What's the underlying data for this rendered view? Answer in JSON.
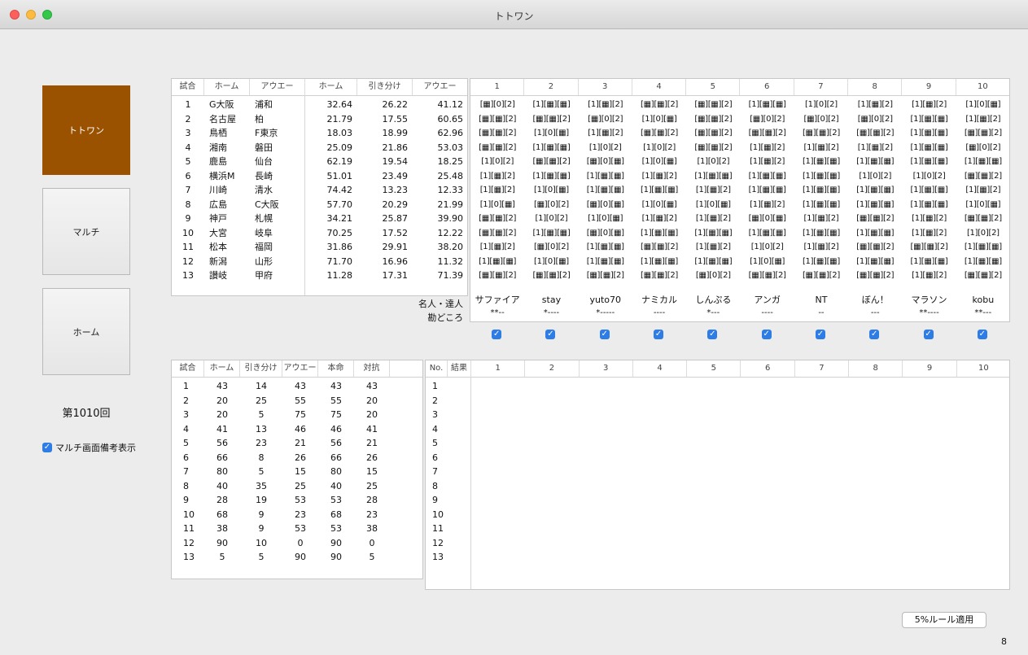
{
  "window": {
    "title": "トトワン"
  },
  "sidebar": {
    "totowan": "トトワン",
    "multi": "マルチ",
    "home": "ホーム",
    "round": "第1010回",
    "multi_note_label": "マルチ画面備考表示",
    "multi_note_checked": true
  },
  "odds_table": {
    "headers": [
      "試合",
      "ホーム",
      "アウエー",
      "ホーム",
      "引き分け",
      "アウエー"
    ],
    "rows": [
      [
        "1",
        "G大阪",
        "浦和",
        "32.64",
        "26.22",
        "41.12"
      ],
      [
        "2",
        "名古屋",
        "柏",
        "21.79",
        "17.55",
        "60.65"
      ],
      [
        "3",
        "鳥栖",
        "F東京",
        "18.03",
        "18.99",
        "62.96"
      ],
      [
        "4",
        "湘南",
        "磐田",
        "25.09",
        "21.86",
        "53.03"
      ],
      [
        "5",
        "鹿島",
        "仙台",
        "62.19",
        "19.54",
        "18.25"
      ],
      [
        "6",
        "横浜M",
        "長崎",
        "51.01",
        "23.49",
        "25.48"
      ],
      [
        "7",
        "川崎",
        "清水",
        "74.42",
        "13.23",
        "12.33"
      ],
      [
        "8",
        "広島",
        "C大阪",
        "57.70",
        "20.29",
        "21.99"
      ],
      [
        "9",
        "神戸",
        "札幌",
        "34.21",
        "25.87",
        "39.90"
      ],
      [
        "10",
        "大宮",
        "岐阜",
        "70.25",
        "17.52",
        "12.22"
      ],
      [
        "11",
        "松本",
        "福岡",
        "31.86",
        "29.91",
        "38.20"
      ],
      [
        "12",
        "新潟",
        "山形",
        "71.70",
        "16.96",
        "11.32"
      ],
      [
        "13",
        "讃岐",
        "甲府",
        "11.28",
        "17.31",
        "71.39"
      ]
    ]
  },
  "expert_table": {
    "headers": [
      "1",
      "2",
      "3",
      "4",
      "5",
      "6",
      "7",
      "8",
      "9",
      "10"
    ],
    "rows": [
      [
        "[▦][0][2]",
        "[1][▦][▦]",
        "[1][▦][2]",
        "[▦][▦][2]",
        "[▦][▦][2]",
        "[1][▦][▦]",
        "[1][0][2]",
        "[1][▦][2]",
        "[1][▦][2]",
        "[1][0][▦]"
      ],
      [
        "[▦][▦][2]",
        "[▦][▦][2]",
        "[▦][0][2]",
        "[1][0][▦]",
        "[▦][▦][2]",
        "[▦][0][2]",
        "[▦][0][2]",
        "[▦][0][2]",
        "[1][▦][▦]",
        "[1][▦][2]"
      ],
      [
        "[▦][▦][2]",
        "[1][0][▦]",
        "[1][▦][2]",
        "[▦][▦][2]",
        "[▦][▦][2]",
        "[▦][▦][2]",
        "[▦][▦][2]",
        "[▦][▦][2]",
        "[1][▦][▦]",
        "[▦][▦][2]"
      ],
      [
        "[▦][▦][2]",
        "[1][▦][▦]",
        "[1][0][2]",
        "[1][0][2]",
        "[▦][▦][2]",
        "[1][▦][2]",
        "[1][▦][2]",
        "[1][▦][2]",
        "[1][▦][▦]",
        "[▦][0][2]"
      ],
      [
        "[1][0][2]",
        "[▦][▦][2]",
        "[▦][0][▦]",
        "[1][0][▦]",
        "[1][0][2]",
        "[1][▦][2]",
        "[1][▦][▦]",
        "[1][▦][▦]",
        "[1][▦][▦]",
        "[1][▦][▦]"
      ],
      [
        "[1][▦][2]",
        "[1][▦][▦]",
        "[1][▦][▦]",
        "[1][▦][2]",
        "[1][▦][▦]",
        "[1][▦][▦]",
        "[1][▦][▦]",
        "[1][0][2]",
        "[1][0][2]",
        "[▦][▦][2]"
      ],
      [
        "[1][▦][2]",
        "[1][0][▦]",
        "[1][▦][▦]",
        "[1][▦][▦]",
        "[1][▦][2]",
        "[1][▦][▦]",
        "[1][▦][▦]",
        "[1][▦][▦]",
        "[1][▦][▦]",
        "[1][▦][2]"
      ],
      [
        "[1][0][▦]",
        "[▦][0][2]",
        "[▦][0][▦]",
        "[1][0][▦]",
        "[1][0][▦]",
        "[1][▦][2]",
        "[1][▦][▦]",
        "[1][▦][▦]",
        "[1][▦][▦]",
        "[1][0][▦]"
      ],
      [
        "[▦][▦][2]",
        "[1][0][2]",
        "[1][0][▦]",
        "[1][▦][2]",
        "[1][▦][2]",
        "[▦][0][▦]",
        "[1][▦][2]",
        "[▦][▦][2]",
        "[1][▦][2]",
        "[▦][▦][2]"
      ],
      [
        "[▦][▦][2]",
        "[1][▦][▦]",
        "[▦][0][▦]",
        "[1][▦][▦]",
        "[1][▦][▦]",
        "[1][▦][▦]",
        "[1][▦][▦]",
        "[1][▦][▦]",
        "[1][▦][2]",
        "[1][0][2]"
      ],
      [
        "[1][▦][2]",
        "[▦][0][2]",
        "[1][▦][▦]",
        "[▦][▦][2]",
        "[1][▦][2]",
        "[1][0][2]",
        "[1][▦][2]",
        "[▦][▦][2]",
        "[▦][▦][2]",
        "[1][▦][▦]"
      ],
      [
        "[1][▦][▦]",
        "[1][0][▦]",
        "[1][▦][▦]",
        "[1][▦][▦]",
        "[1][▦][▦]",
        "[1][0][▦]",
        "[1][▦][▦]",
        "[1][▦][▦]",
        "[1][▦][▦]",
        "[1][▦][▦]"
      ],
      [
        "[▦][▦][2]",
        "[▦][▦][2]",
        "[▦][▦][2]",
        "[▦][▦][2]",
        "[▦][0][2]",
        "[▦][▦][2]",
        "[▦][▦][2]",
        "[▦][▦][2]",
        "[1][▦][2]",
        "[▦][▦][2]"
      ]
    ],
    "row_label_names": "名人・達人",
    "row_label_stars": "勘どころ",
    "expert_names": [
      "サファイア",
      "stay",
      "yuto70",
      "ナミカル",
      "しんぷる",
      "アンガ",
      "NT",
      "ぼん！",
      "マラソン",
      "kobu"
    ],
    "expert_stars": [
      "**--",
      "*----",
      "*-----",
      "----",
      "*---",
      "----",
      "--",
      "---",
      "**----",
      "**---"
    ],
    "expert_checked": [
      true,
      true,
      true,
      true,
      true,
      true,
      true,
      true,
      true,
      true
    ]
  },
  "vote_table": {
    "headers": [
      "試合",
      "ホーム",
      "引き分け",
      "アウエー",
      "本命",
      "対抗"
    ],
    "rows": [
      [
        "1",
        "43",
        "14",
        "43",
        "43",
        "43"
      ],
      [
        "2",
        "20",
        "25",
        "55",
        "55",
        "20"
      ],
      [
        "3",
        "20",
        "5",
        "75",
        "75",
        "20"
      ],
      [
        "4",
        "41",
        "13",
        "46",
        "46",
        "41"
      ],
      [
        "5",
        "56",
        "23",
        "21",
        "56",
        "21"
      ],
      [
        "6",
        "66",
        "8",
        "26",
        "66",
        "26"
      ],
      [
        "7",
        "80",
        "5",
        "15",
        "80",
        "15"
      ],
      [
        "8",
        "40",
        "35",
        "25",
        "40",
        "25"
      ],
      [
        "9",
        "28",
        "19",
        "53",
        "53",
        "28"
      ],
      [
        "10",
        "68",
        "9",
        "23",
        "68",
        "23"
      ],
      [
        "11",
        "38",
        "9",
        "53",
        "53",
        "38"
      ],
      [
        "12",
        "90",
        "10",
        "0",
        "90",
        "0"
      ],
      [
        "13",
        "5",
        "5",
        "90",
        "90",
        "5"
      ]
    ]
  },
  "result_table": {
    "headers": [
      "No.",
      "結果",
      "1",
      "2",
      "3",
      "4",
      "5",
      "6",
      "7",
      "8",
      "9",
      "10"
    ],
    "nos": [
      "1",
      "2",
      "3",
      "4",
      "5",
      "6",
      "7",
      "8",
      "9",
      "10",
      "11",
      "12",
      "13"
    ]
  },
  "rule_button": "5%ルール適用",
  "counter": "8"
}
